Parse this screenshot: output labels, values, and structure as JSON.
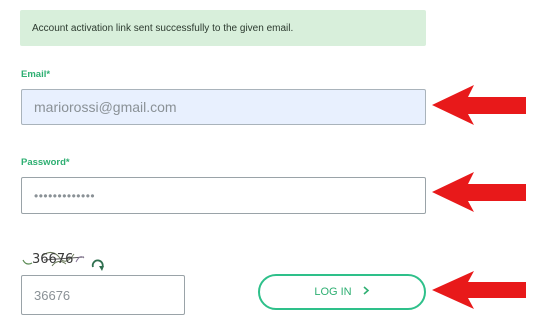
{
  "alert": {
    "message": "Account activation link sent successfully to the given email."
  },
  "email": {
    "label": "Email*",
    "value": "mariorossi@gmail.com"
  },
  "password": {
    "label": "Password*",
    "value": "•••••••••••••"
  },
  "captcha": {
    "image_text": "36676",
    "input_value": "36676",
    "refresh_icon": "refresh-icon"
  },
  "login": {
    "label": "LOG IN",
    "icon": "chevron-right-icon"
  },
  "colors": {
    "accent": "#2eaf72",
    "alert_bg": "#d8efdb",
    "email_bg": "#e8f0fe",
    "annotation_arrow": "#e8191a"
  }
}
